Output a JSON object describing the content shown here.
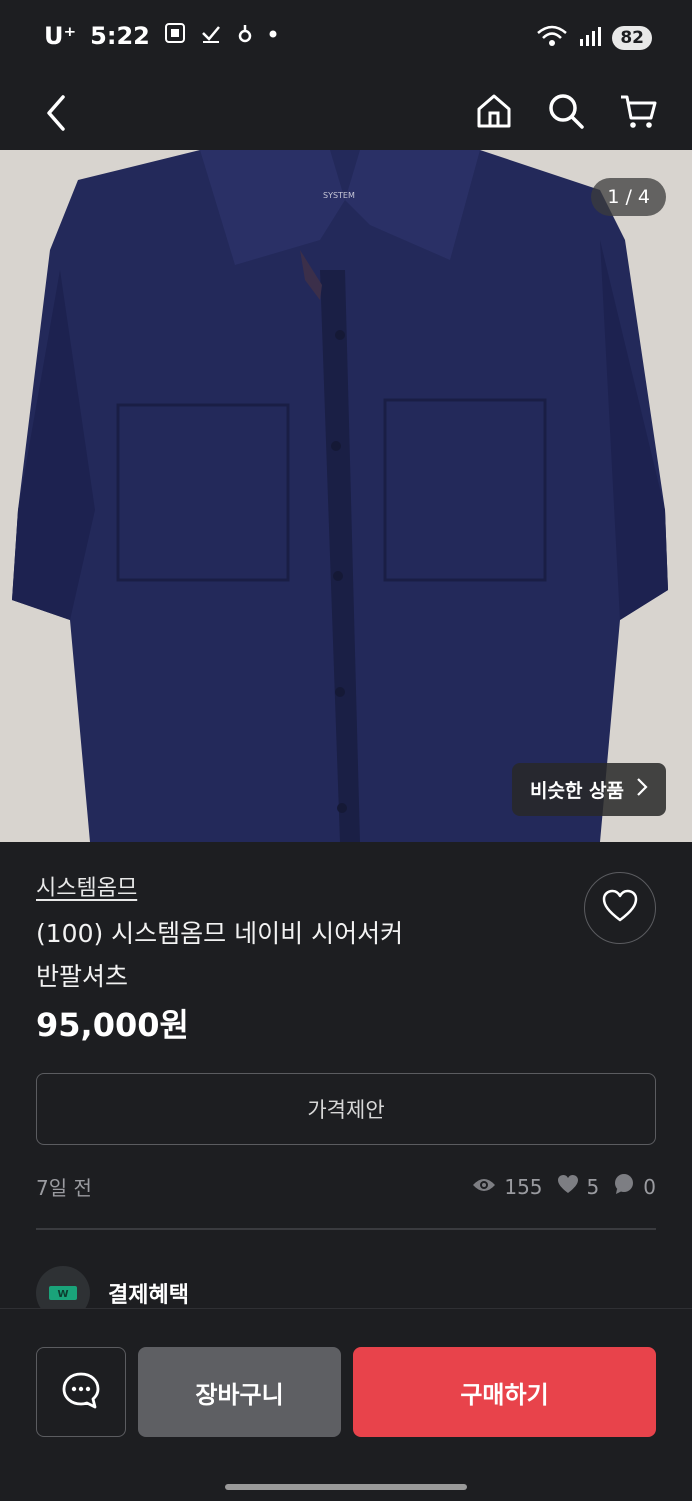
{
  "status_bar": {
    "carrier": "U⁺",
    "time": "5:22",
    "battery": "82"
  },
  "hero": {
    "counter": "1 / 4",
    "similar_label": "비슷한 상품",
    "shirt_tag": "SYSTEM"
  },
  "product": {
    "brand": "시스템옴므",
    "title_line1": "(100) 시스템옴므 네이비 시어서커",
    "title_line2": "반팔셔츠",
    "price": "95,000원",
    "offer_label": "가격제안",
    "posted": "7일 전",
    "views": "155",
    "likes": "5",
    "comments": "0"
  },
  "benefit": {
    "label": "결제혜택"
  },
  "actions": {
    "cart_label": "장바구니",
    "buy_label": "구매하기"
  },
  "colors": {
    "background": "#1d1e21",
    "buy": "#e8434b",
    "cart": "#5e5f63",
    "shirt": "#23295a"
  },
  "icons": [
    "back-icon",
    "home-icon",
    "search-icon",
    "cart-icon",
    "heart-icon",
    "eye-icon",
    "chat-icon",
    "payment-icon"
  ]
}
